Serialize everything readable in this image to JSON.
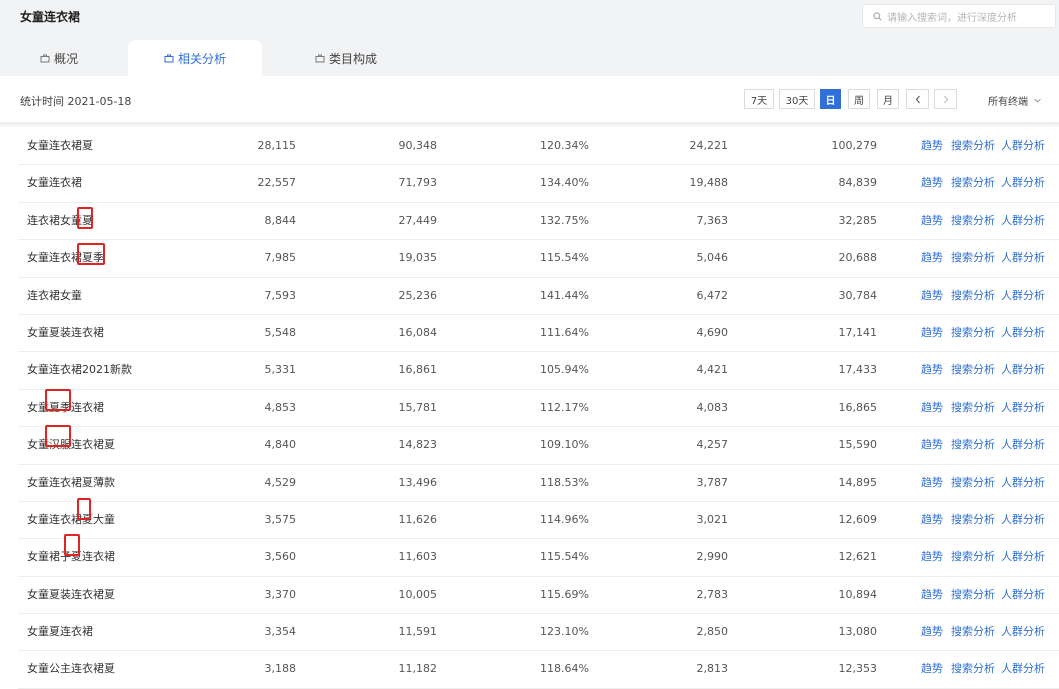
{
  "header": {
    "title": "女童连衣裙",
    "search_placeholder": "请输入搜索词，进行深度分析"
  },
  "tabs": [
    {
      "label": "概况",
      "active": false
    },
    {
      "label": "相关分析",
      "active": true
    },
    {
      "label": "类目构成",
      "active": false
    }
  ],
  "stats": {
    "label": "统计时间 2021-05-18",
    "period_buttons": [
      "7天",
      "30天",
      "日",
      "周",
      "月"
    ],
    "active_period": "日",
    "prev_icon": "chevron-left-icon",
    "next_icon": "chevron-right-icon",
    "device_label": "所有终端"
  },
  "action_labels": {
    "trend": "趋势",
    "search": "搜索分析",
    "crowd": "人群分析"
  },
  "colors": {
    "accent": "#2f6fd7",
    "highlight": "#e02424"
  },
  "rows": [
    {
      "keyword": "女童连衣裙夏",
      "v1": "28,115",
      "v2": "90,348",
      "v3": "120.34%",
      "v4": "24,221",
      "v5": "100,279"
    },
    {
      "keyword": "女童连衣裙",
      "v1": "22,557",
      "v2": "71,793",
      "v3": "134.40%",
      "v4": "19,488",
      "v5": "84,839"
    },
    {
      "keyword": "连衣裙女童夏",
      "v1": "8,844",
      "v2": "27,449",
      "v3": "132.75%",
      "v4": "7,363",
      "v5": "32,285"
    },
    {
      "keyword": "女童连衣裙夏季",
      "v1": "7,985",
      "v2": "19,035",
      "v3": "115.54%",
      "v4": "5,046",
      "v5": "20,688"
    },
    {
      "keyword": "连衣裙女童",
      "v1": "7,593",
      "v2": "25,236",
      "v3": "141.44%",
      "v4": "6,472",
      "v5": "30,784"
    },
    {
      "keyword": "女童夏装连衣裙",
      "v1": "5,548",
      "v2": "16,084",
      "v3": "111.64%",
      "v4": "4,690",
      "v5": "17,141"
    },
    {
      "keyword": "女童连衣裙2021新款",
      "v1": "5,331",
      "v2": "16,861",
      "v3": "105.94%",
      "v4": "4,421",
      "v5": "17,433"
    },
    {
      "keyword": "女童夏季连衣裙",
      "v1": "4,853",
      "v2": "15,781",
      "v3": "112.17%",
      "v4": "4,083",
      "v5": "16,865"
    },
    {
      "keyword": "女童汉服连衣裙夏",
      "v1": "4,840",
      "v2": "14,823",
      "v3": "109.10%",
      "v4": "4,257",
      "v5": "15,590"
    },
    {
      "keyword": "女童连衣裙夏薄款",
      "v1": "4,529",
      "v2": "13,496",
      "v3": "118.53%",
      "v4": "3,787",
      "v5": "14,895"
    },
    {
      "keyword": "女童连衣裙夏大童",
      "v1": "3,575",
      "v2": "11,626",
      "v3": "114.96%",
      "v4": "3,021",
      "v5": "12,609"
    },
    {
      "keyword": "女童裙子夏连衣裙",
      "v1": "3,560",
      "v2": "11,603",
      "v3": "115.54%",
      "v4": "2,990",
      "v5": "12,621"
    },
    {
      "keyword": "女童夏装连衣裙夏",
      "v1": "3,370",
      "v2": "10,005",
      "v3": "115.69%",
      "v4": "2,783",
      "v5": "10,894"
    },
    {
      "keyword": "女童夏连衣裙",
      "v1": "3,354",
      "v2": "11,591",
      "v3": "123.10%",
      "v4": "2,850",
      "v5": "13,080"
    },
    {
      "keyword": "女童公主连衣裙夏",
      "v1": "3,188",
      "v2": "11,182",
      "v3": "118.64%",
      "v4": "2,813",
      "v5": "12,353"
    }
  ]
}
